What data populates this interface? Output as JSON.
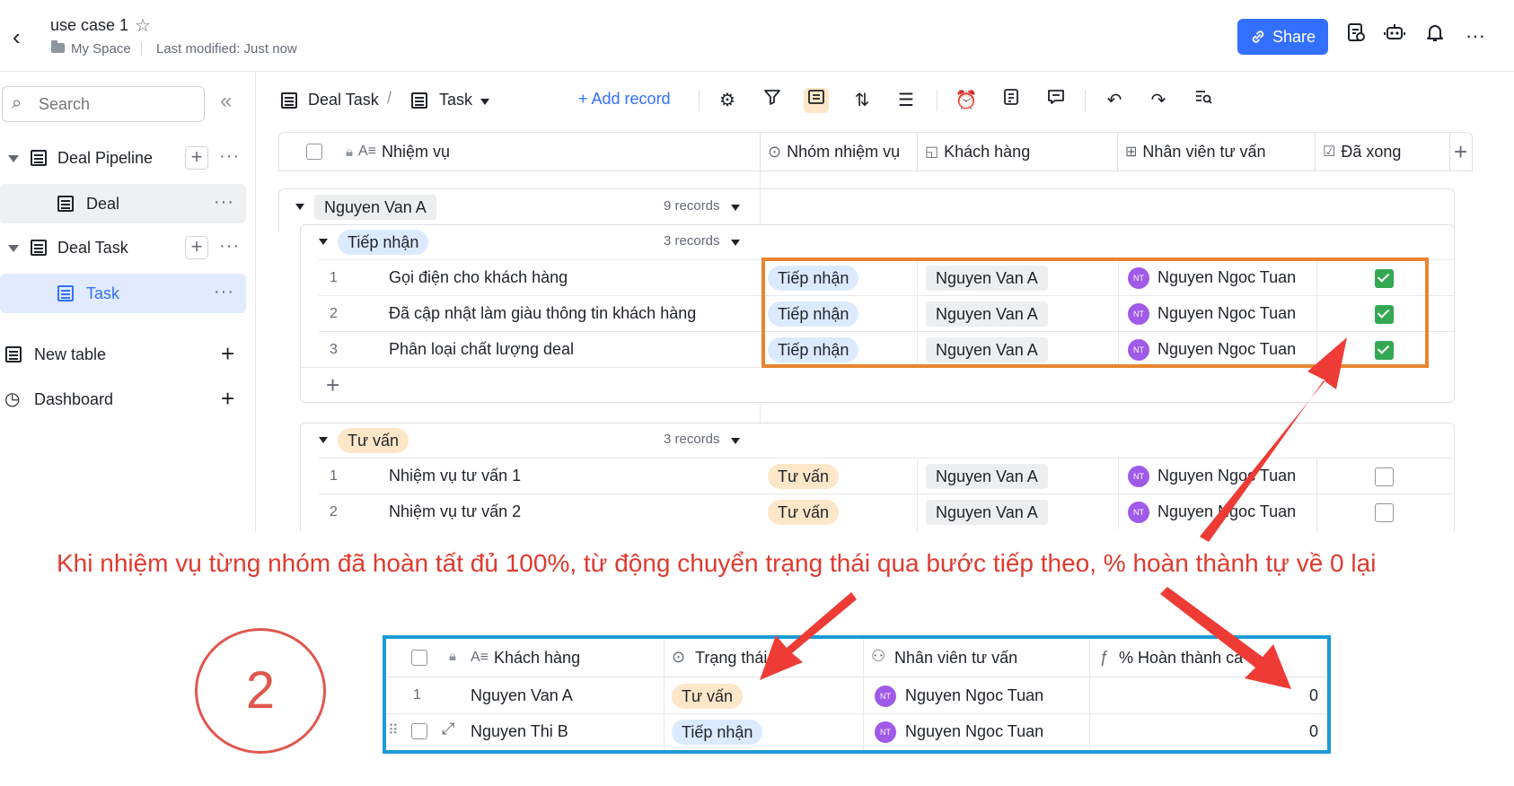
{
  "header": {
    "title": "use case 1",
    "space": "My Space",
    "modified": "Last modified: Just now",
    "share_label": "Share"
  },
  "sidebar": {
    "search_placeholder": "Search",
    "items": [
      {
        "label": "Deal Pipeline"
      },
      {
        "label": "Deal"
      },
      {
        "label": "Deal Task"
      },
      {
        "label": "Task"
      },
      {
        "label": "New table"
      },
      {
        "label": "Dashboard"
      }
    ]
  },
  "toolbar": {
    "table_name": "Deal Task",
    "view_name": "Task",
    "add_record": "+ Add record"
  },
  "grid": {
    "columns": [
      "Nhiệm vụ",
      "Nhóm nhiệm vụ",
      "Khách hàng",
      "Nhân viên tư vấn",
      "Đã xong"
    ],
    "group": {
      "name": "Nguyen Van A",
      "count": "9 records"
    },
    "subgroups": [
      {
        "name": "Tiếp nhận",
        "count": "3 records",
        "rows": [
          {
            "num": "1",
            "task": "Gọi điện cho khách hàng",
            "group": "Tiếp nhận",
            "customer": "Nguyen Van A",
            "staff": "Nguyen Ngoc Tuan",
            "done": true
          },
          {
            "num": "2",
            "task": "Đã cập nhật làm giàu thông tin khách hàng",
            "group": "Tiếp nhận",
            "customer": "Nguyen Van A",
            "staff": "Nguyen Ngoc Tuan",
            "done": true
          },
          {
            "num": "3",
            "task": "Phân loại chất lượng deal",
            "group": "Tiếp nhận",
            "customer": "Nguyen Van A",
            "staff": "Nguyen Ngoc Tuan",
            "done": true
          }
        ]
      },
      {
        "name": "Tư vấn",
        "count": "3 records",
        "rows": [
          {
            "num": "1",
            "task": "Nhiệm vụ tư vấn 1",
            "group": "Tư vấn",
            "customer": "Nguyen Van A",
            "staff": "Nguyen Ngoc Tuan",
            "done": false
          },
          {
            "num": "2",
            "task": "Nhiệm vụ tư vấn 2",
            "group": "Tư vấn",
            "customer": "Nguyen Van A",
            "staff": "Nguyen Ngoc Tuan",
            "done": false
          }
        ]
      }
    ],
    "avatar_initials": "NT"
  },
  "annotation": {
    "text": "Khi nhiệm vụ từng nhóm đã hoàn tất đủ 100%, từ động chuyển trạng thái qua bước tiếp theo, % hoàn thành tự về 0 lại",
    "step": "2",
    "color": "#e03a2f"
  },
  "bottom_table": {
    "columns": [
      "Khách hàng",
      "Trạng thái",
      "Nhân viên tư vấn",
      "% Hoàn thành cá"
    ],
    "rows": [
      {
        "num": "1",
        "customer": "Nguyen Van A",
        "status": "Tư vấn",
        "staff": "Nguyen Ngoc Tuan",
        "percent": "0"
      },
      {
        "num": "",
        "customer": "Nguyen Thi B",
        "status": "Tiếp nhận",
        "staff": "Nguyen Ngoc Tuan",
        "percent": "0"
      }
    ]
  },
  "colors": {
    "accent": "#3370ff",
    "highlight_box": "#e8852f",
    "bottom_box": "#1a9ad6",
    "arrow": "#ef3b36"
  }
}
